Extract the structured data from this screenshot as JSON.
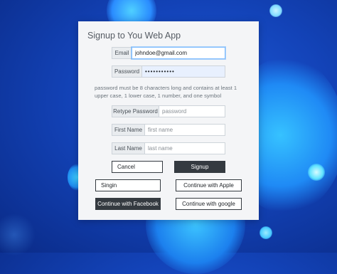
{
  "app": {
    "title": "Signup to You Web App"
  },
  "form": {
    "email": {
      "label": "Email",
      "value": "johndoe@gmail.com",
      "placeholder": ""
    },
    "password": {
      "label": "Password",
      "value": "•••••••••••",
      "placeholder": ""
    },
    "password_hint": "password must be 8 characters long and contains at least 1 upper case, 1 lower case, 1 number, and one symbol",
    "retype_password": {
      "label": "Retype Password",
      "value": "",
      "placeholder": "password"
    },
    "first_name": {
      "label": "First Name",
      "value": "",
      "placeholder": "first name"
    },
    "last_name": {
      "label": "Last Name",
      "value": "",
      "placeholder": "last name"
    }
  },
  "buttons": {
    "cancel": "Cancel",
    "signup": "Signup",
    "signin": "Singin",
    "apple": "Continue with Apple",
    "facebook": "Continue with Facebook",
    "google": "Continue with google"
  },
  "colors": {
    "accent_dark": "#343a40",
    "focus_border": "#80bdff",
    "background": "#1343b8"
  }
}
